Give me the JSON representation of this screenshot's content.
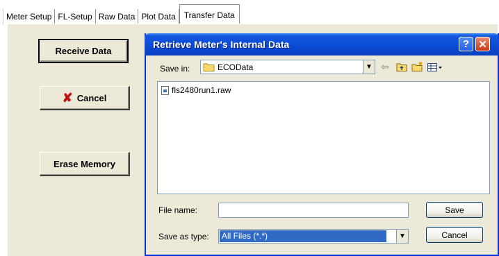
{
  "tabs": [
    {
      "label": "Meter Setup"
    },
    {
      "label": "FL-Setup"
    },
    {
      "label": "Raw Data"
    },
    {
      "label": "Plot Data"
    },
    {
      "label": "Transfer Data",
      "active": true
    }
  ],
  "buttons": {
    "receive": "Receive Data",
    "cancel": "Cancel",
    "erase": "Erase Memory"
  },
  "dialog": {
    "title": "Retrieve Meter's Internal Data",
    "help_glyph": "?",
    "close_glyph": "✕",
    "save_in_label": "Save in:",
    "save_in_value": "ECOData",
    "files": [
      "fls2480run1.raw"
    ],
    "file_name_label": "File name:",
    "file_name_value": "",
    "save_as_type_label": "Save as type:",
    "save_as_type_value": "All Files (*.*)",
    "save_button": "Save",
    "cancel_button": "Cancel"
  },
  "icons": {
    "cancel": "x-icon",
    "folder": "folder-icon",
    "back": "back-arrow-icon",
    "up": "up-folder-icon",
    "new_folder": "new-folder-icon",
    "view": "view-menu-icon",
    "file": "raw-file-icon"
  },
  "colors": {
    "titlebar": "#0a49d4",
    "panel": "#ece9d8",
    "selection": "#316ac5",
    "cancel_x": "#c01010"
  }
}
